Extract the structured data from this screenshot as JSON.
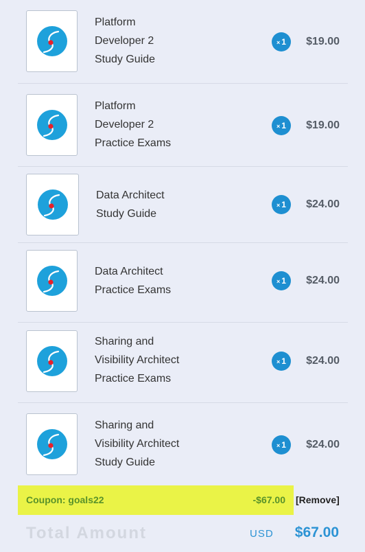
{
  "items": [
    {
      "name_lines": [
        "Platform",
        "Developer 2",
        "Study Guide"
      ],
      "quantity": "1",
      "price": "$19.00",
      "thumbnail_icon": "product-logo-icon"
    },
    {
      "name_lines": [
        "Platform",
        "Developer 2",
        "Practice Exams"
      ],
      "quantity": "1",
      "price": "$19.00",
      "thumbnail_icon": "product-logo-icon"
    },
    {
      "name_lines": [
        "Data Architect",
        "Study Guide"
      ],
      "quantity": "1",
      "price": "$24.00",
      "thumbnail_icon": "product-logo-icon"
    },
    {
      "name_lines": [
        "Data Architect",
        "Practice Exams"
      ],
      "quantity": "1",
      "price": "$24.00",
      "thumbnail_icon": "product-logo-icon"
    },
    {
      "name_lines": [
        "Sharing and",
        "Visibility Architect",
        "Practice Exams"
      ],
      "quantity": "1",
      "price": "$24.00",
      "thumbnail_icon": "product-logo-icon"
    },
    {
      "name_lines": [
        "Sharing and",
        "Visibility Architect",
        "Study Guide"
      ],
      "quantity": "1",
      "price": "$24.00",
      "thumbnail_icon": "product-logo-icon"
    }
  ],
  "quantity_prefix": "×",
  "coupon": {
    "label": "Coupon: goals22",
    "amount": "-$67.00",
    "remove_label": "[Remove]",
    "highlight_color": "#eaf347",
    "text_color": "#59922a"
  },
  "total": {
    "label": "Total Amount",
    "currency": "USD",
    "value": "$67.00"
  },
  "colors": {
    "accent": "#1e8fd1",
    "logo_blue": "#1ea1db",
    "logo_dot": "#e8202a"
  }
}
